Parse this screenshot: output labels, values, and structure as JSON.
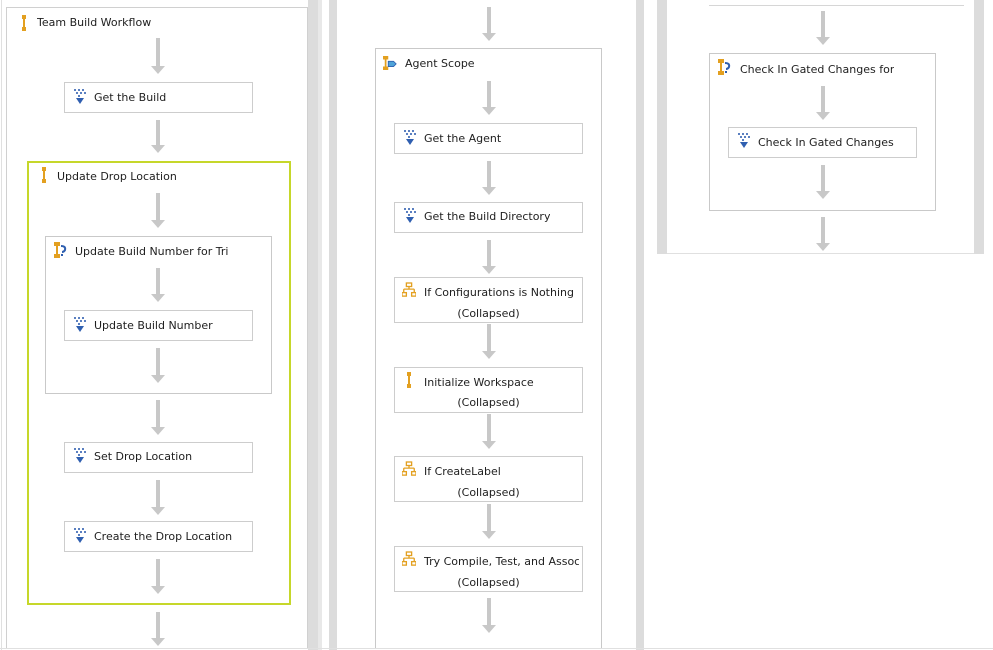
{
  "column1": {
    "root_title": "Team Build Workflow",
    "get_build": "Get the Build",
    "update_drop_scope": "Update Drop Location",
    "update_build_number_scope": "Update Build Number for Trigg",
    "update_build_number": "Update Build Number",
    "set_drop_location": "Set Drop Location",
    "create_drop_location": "Create the Drop Location"
  },
  "column2": {
    "agent_scope": "Agent Scope",
    "get_agent": "Get the Agent",
    "get_build_directory": "Get the Build Directory",
    "if_configurations": "If Configurations is Nothing",
    "if_configurations_state": "(Collapsed)",
    "initialize_workspace": "Initialize Workspace",
    "initialize_workspace_state": "(Collapsed)",
    "if_create_label": "If CreateLabel",
    "if_create_label_state": "(Collapsed)",
    "try_compile": "Try Compile, Test, and Associat",
    "try_compile_state": "(Collapsed)"
  },
  "column3": {
    "check_in_scope": "Check In Gated Changes for fo",
    "check_in": "Check In Gated Changes"
  },
  "colors": {
    "selection": "#c6d72a",
    "arrow": "#c8c8c8",
    "sequence_icon": "#e3a020",
    "activity_icon": "#2f5fb0"
  },
  "icons": {
    "sequence": "sequence-icon",
    "activity": "activity-icon",
    "if": "flowchart-icon",
    "scope": "scope-icon"
  }
}
